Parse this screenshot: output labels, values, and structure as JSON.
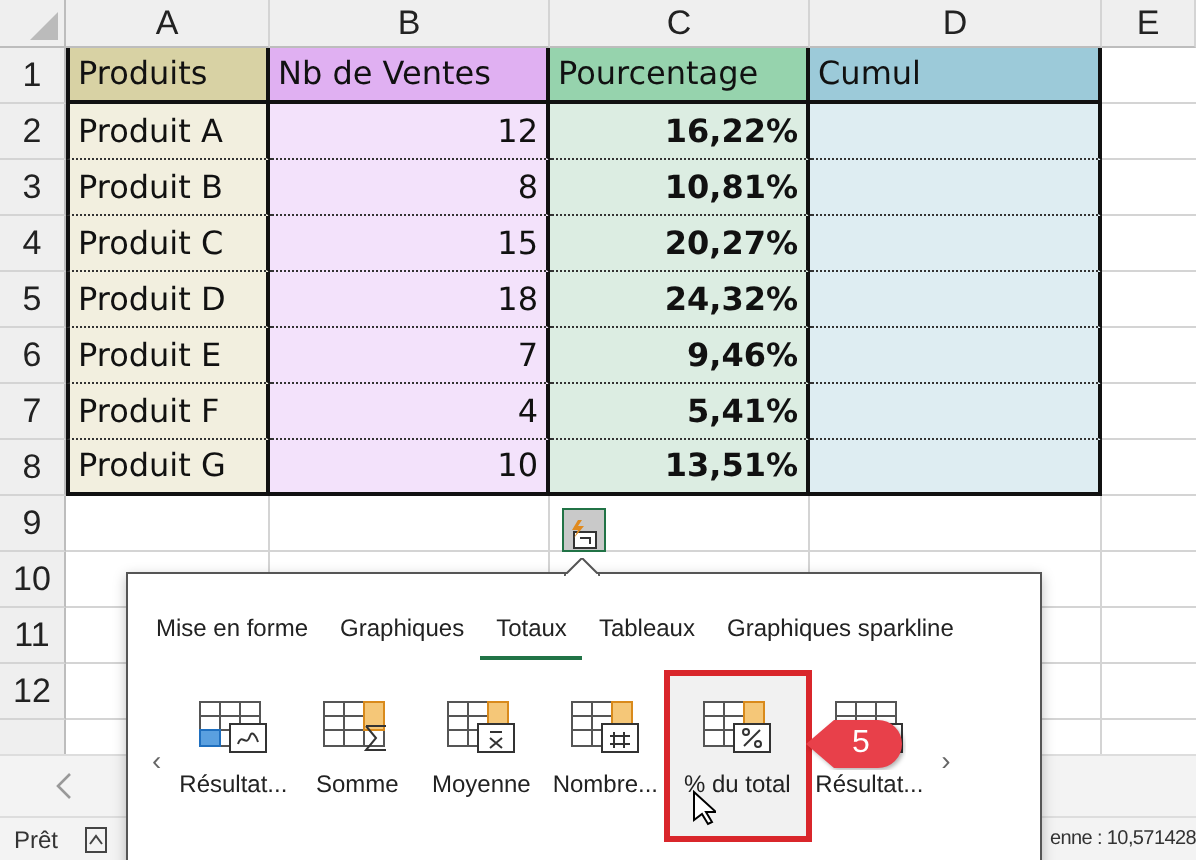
{
  "columns": [
    {
      "letter": "A",
      "color": "#f2efdf"
    },
    {
      "letter": "B",
      "color": "#f3e2fb"
    },
    {
      "letter": "C",
      "color": "#dcede2"
    },
    {
      "letter": "D",
      "color": "#deedf2"
    },
    {
      "letter": "E"
    }
  ],
  "headers": [
    {
      "text": "Produits",
      "color": "#d8d2a4"
    },
    {
      "text": "Nb de Ventes",
      "color": "#e0b0f2"
    },
    {
      "text": "Pourcentage",
      "color": "#96d3ad"
    },
    {
      "text": "Cumul",
      "color": "#9ccad9"
    }
  ],
  "header_row_number": "1",
  "rows": [
    {
      "number": "2",
      "product": "Produit A",
      "sales": "12",
      "percent": "16,22%"
    },
    {
      "number": "3",
      "product": "Produit B",
      "sales": "8",
      "percent": "10,81%"
    },
    {
      "number": "4",
      "product": "Produit C",
      "sales": "15",
      "percent": "20,27%"
    },
    {
      "number": "5",
      "product": "Produit D",
      "sales": "18",
      "percent": "24,32%"
    },
    {
      "number": "6",
      "product": "Produit E",
      "sales": "7",
      "percent": "9,46%"
    },
    {
      "number": "7",
      "product": "Produit F",
      "sales": "4",
      "percent": "5,41%"
    },
    {
      "number": "8",
      "product": "Produit G",
      "sales": "10",
      "percent": "13,51%"
    }
  ],
  "empty_rows": [
    "9",
    "10",
    "11",
    "12"
  ],
  "quick_analysis": {
    "tabs": [
      {
        "label": "Mise en forme",
        "selected": false
      },
      {
        "label": "Graphiques",
        "selected": false
      },
      {
        "label": "Totaux",
        "selected": true
      },
      {
        "label": "Tableaux",
        "selected": false
      },
      {
        "label": "Graphiques sparkline",
        "selected": false
      }
    ],
    "prev": "‹",
    "next": "›",
    "items": [
      {
        "label": "Résultat...",
        "kind": "running",
        "highlighted": false
      },
      {
        "label": "Somme",
        "kind": "sum",
        "highlighted": false
      },
      {
        "label": "Moyenne",
        "kind": "mean",
        "highlighted": false
      },
      {
        "label": "Nombre...",
        "kind": "count",
        "highlighted": false
      },
      {
        "label": "% du total",
        "kind": "percent",
        "highlighted": true
      },
      {
        "label": "Résultat...",
        "kind": "running",
        "highlighted": false
      }
    ],
    "callout": "5"
  },
  "status_bar": {
    "state": "Prêt",
    "summary": "enne : 10,571428"
  }
}
